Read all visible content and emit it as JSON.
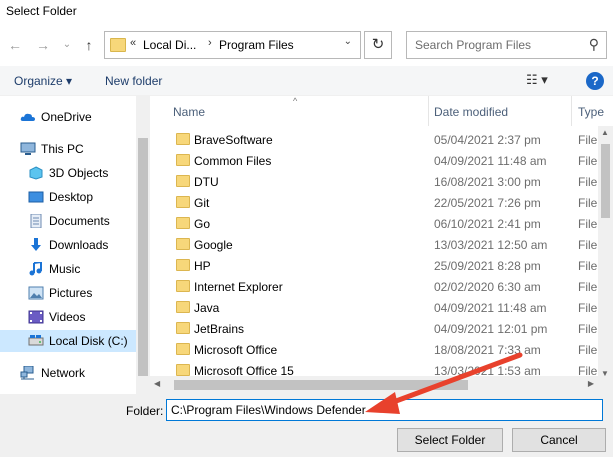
{
  "window": {
    "title": "Select Folder"
  },
  "navigation": {
    "back_icon": "←",
    "forward_icon": "→",
    "recent_icon": "⌄",
    "up_icon": "↑",
    "address": {
      "overflow": "«",
      "crumbs": [
        "Local Di...",
        "Program Files"
      ],
      "separator": "›",
      "dropdown": "⌄"
    },
    "refresh_icon": "↻",
    "search": {
      "placeholder": "Search Program Files",
      "icon": "⚲"
    }
  },
  "toolbar": {
    "organize_label": "Organize ▾",
    "new_folder_label": "New folder",
    "view_label": "☷ ▾",
    "help_label": "?"
  },
  "sidebar": {
    "items": [
      {
        "label": "OneDrive",
        "icon": "cloud-icon"
      },
      {
        "label": "This PC",
        "icon": "computer-icon"
      },
      {
        "label": "3D Objects",
        "icon": "cube-icon"
      },
      {
        "label": "Desktop",
        "icon": "desktop-icon"
      },
      {
        "label": "Documents",
        "icon": "documents-icon"
      },
      {
        "label": "Downloads",
        "icon": "download-icon"
      },
      {
        "label": "Music",
        "icon": "music-icon"
      },
      {
        "label": "Pictures",
        "icon": "pictures-icon"
      },
      {
        "label": "Videos",
        "icon": "videos-icon"
      },
      {
        "label": "Local Disk (C:)",
        "icon": "drive-icon",
        "selected": true
      },
      {
        "label": "Network",
        "icon": "network-icon"
      }
    ]
  },
  "file_list": {
    "columns": [
      "Name",
      "Date modified",
      "Type"
    ],
    "rows": [
      {
        "name": "BraveSoftware",
        "date": "05/04/2021 2:37 pm",
        "type": "File f"
      },
      {
        "name": "Common Files",
        "date": "04/09/2021 11:48 am",
        "type": "File f"
      },
      {
        "name": "DTU",
        "date": "16/08/2021 3:00 pm",
        "type": "File f"
      },
      {
        "name": "Git",
        "date": "22/05/2021 7:26 pm",
        "type": "File f"
      },
      {
        "name": "Go",
        "date": "06/10/2021 2:41 pm",
        "type": "File f"
      },
      {
        "name": "Google",
        "date": "13/03/2021 12:50 am",
        "type": "File f"
      },
      {
        "name": "HP",
        "date": "25/09/2021 8:28 pm",
        "type": "File f"
      },
      {
        "name": "Internet Explorer",
        "date": "02/02/2020 6:30 am",
        "type": "File f"
      },
      {
        "name": "Java",
        "date": "04/09/2021 11:48 am",
        "type": "File f"
      },
      {
        "name": "JetBrains",
        "date": "04/09/2021 12:01 pm",
        "type": "File f"
      },
      {
        "name": "Microsoft Office",
        "date": "18/08/2021 7:33 am",
        "type": "File f"
      },
      {
        "name": "Microsoft Office 15",
        "date": "13/03/2021 1:53 am",
        "type": "File f"
      }
    ]
  },
  "footer": {
    "folder_label": "Folder:",
    "folder_value": "C:\\Program Files\\Windows Defender",
    "select_button": "Select Folder",
    "cancel_button": "Cancel"
  },
  "colors": {
    "selection": "#cce8ff",
    "accent": "#0078d7",
    "annotation_arrow": "#e8412c"
  }
}
